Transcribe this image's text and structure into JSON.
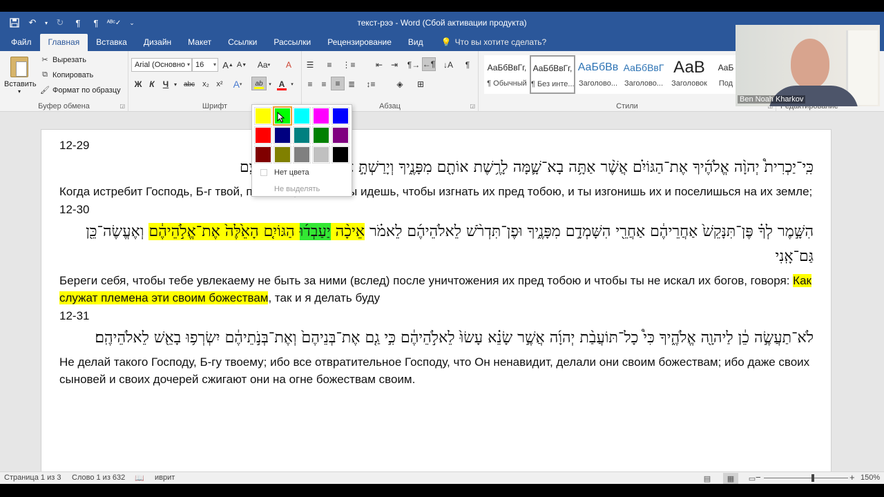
{
  "window": {
    "title": "текст-рээ - Word (Сбой активации продукта)"
  },
  "qat": [
    {
      "name": "save-icon",
      "glyph": "💾"
    },
    {
      "name": "undo-icon",
      "glyph": "↶"
    },
    {
      "name": "redo-icon",
      "glyph": "↻"
    },
    {
      "name": "pilcrow-ltr-icon",
      "glyph": "¶"
    },
    {
      "name": "pilcrow-rtl-icon",
      "glyph": "¶"
    },
    {
      "name": "spelling-icon",
      "glyph": "✓"
    },
    {
      "name": "customize-qat-icon",
      "glyph": "⌄"
    }
  ],
  "tabs": [
    "Файл",
    "Главная",
    "Вставка",
    "Дизайн",
    "Макет",
    "Ссылки",
    "Рассылки",
    "Рецензирование",
    "Вид"
  ],
  "tell_me": "Что вы хотите сделать?",
  "ribbon": {
    "clipboard": {
      "paste": "Вставить",
      "cut": "Вырезать",
      "copy": "Копировать",
      "format_painter": "Формат по образцу",
      "label": "Буфер обмена"
    },
    "font": {
      "name": "Arial (Основно",
      "size": "16",
      "label": "Шрифт",
      "bold": "Ж",
      "italic": "К",
      "underline": "Ч",
      "strike": "abc",
      "sub": "x₂",
      "sup": "x²",
      "grow": "A",
      "shrink": "A",
      "case": "Aa",
      "clear": "A",
      "effects": "A",
      "highlight": "ab",
      "font_color": "A"
    },
    "paragraph": {
      "label": "Абзац"
    },
    "styles": {
      "label": "Стили",
      "items": [
        {
          "preview": "АаБбВвГг,",
          "name": "¶ Обычный"
        },
        {
          "preview": "АаБбВвГг,",
          "name": "¶ Без инте..."
        },
        {
          "preview": "АаБбВв",
          "name": "Заголово..."
        },
        {
          "preview": "АаБбВвГ",
          "name": "Заголово..."
        },
        {
          "preview": "АаВ",
          "name": "Заголовок"
        },
        {
          "preview": "АаБ",
          "name": "Под"
        }
      ]
    },
    "editing": {
      "label": "Редактирование"
    }
  },
  "webcam": {
    "name": "Ben Noah Kharkov"
  },
  "document": {
    "blocks": [
      {
        "ref": "12-29",
        "heb": "כִּֽי־יַכְרִית֩ יְהוָ֨ה אֱלֹהֶ֜יךָ אֶת־הַגּוֹיִ֗ם אֲשֶׁ֨ר אַתָּ֥ה בָא־שָׁ֛מָּה לָרֶ֥שֶׁת אוֹתָ֖ם מִפָּנֶ֑יךָ וְיָרַשְׁתָּ֣ אֹתָ֔ם וְיָשַׁבְתָּ֖ בְּאַרְצָֽם",
        "ru": "Когда истребит Господь, Б-г твой, племена, к каким ты идешь, чтобы изгнать их пред тобою, и ты изгонишь их и поселишься на их земле;"
      },
      {
        "ref": "12-30",
        "heb_parts": [
          {
            "text": "הִשָּׁ֣מֶר לְךָ֗ פֶּן־תִּנָּקֵשׁ֙ אַחֲרֵיהֶ֔ם אַחֲרֵ֖י הִשָּׁמְדָ֣ם מִפָּנֶ֑יךָ וּפֶן־תִּדְרֹ֨שׁ לֵאלֹהֵיהֶ֜ם לֵאמֹ֗ר ",
            "hl": ""
          },
          {
            "text": "אֵיכָ֨ה ",
            "hl": "y"
          },
          {
            "text": "יַעַבְד֜וּ",
            "hl": "g"
          },
          {
            "text": " הַגּוֹיִ֤ם הָאֵ֙לֶּה֙ אֶת־אֱלֹ֣הֵיהֶ֔ם",
            "hl": "y"
          },
          {
            "text": " וְאֶעֱשֶׂה־כֵּ֖ן גַּם־אָֽנִי",
            "hl": ""
          }
        ],
        "ru_parts": [
          {
            "text": "Береги себя, чтобы тебе увлекаему не быть за ними (вслед) после уничтожения их пред тобою и чтобы ты не искал их богов, говоря: ",
            "hl": ""
          },
          {
            "text": "Как служат племена эти своим божествам",
            "hl": "y"
          },
          {
            "text": ", так и я делать буду",
            "hl": ""
          }
        ]
      },
      {
        "ref": "12-31",
        "heb": "לֹא־תַעֲשֶׂ֣ה כֵ֔ן לַיהוָ֖ה אֱלֹהֶ֑יךָ כִּי֩ כָל־תּוֹעֲבַ֨ת יְהוָ֜ה אֲשֶׁ֣ר שָׂנֵ֗א עָשׂוּ֙ לֵאלֹ֣הֵיהֶ֔ם כִּ֣י גַ֤ם אֶת־בְּנֵיהֶם֙ וְאֶת־בְּנֹ֣תֵיהֶ֔ם יִשְׂרְפ֥וּ בָאֵ֖שׁ לֵאלֹהֵיהֶֽם׃",
        "ru": "Не делай такого Господу, Б-гу твоему; ибо все отвратительное Господу, что Он ненавидит, делали они своим божествам; ибо даже своих сыновей и своих дочерей сжигают они на огне божествам своим."
      }
    ]
  },
  "highlight_menu": {
    "colors": [
      "#ffff00",
      "#00ff00",
      "#00ffff",
      "#ff00ff",
      "#0000ff",
      "#ff0000",
      "#000080",
      "#008080",
      "#008000",
      "#800080",
      "#800000",
      "#808000",
      "#808080",
      "#c0c0c0",
      "#000000"
    ],
    "hovered_index": 1,
    "no_color": "Нет цвета",
    "stop": "Не выделять"
  },
  "status": {
    "page": "Страница 1 из 3",
    "words": "Слово 1 из 632",
    "language": "иврит",
    "zoom": "150%"
  }
}
